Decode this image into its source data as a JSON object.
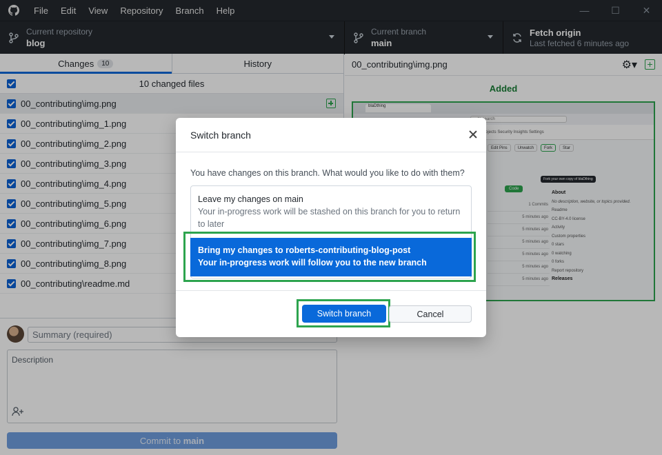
{
  "menu": [
    "File",
    "Edit",
    "View",
    "Repository",
    "Branch",
    "Help"
  ],
  "window_controls": [
    "—",
    "☐",
    "✕"
  ],
  "toolbar": {
    "repo_label": "Current repository",
    "repo_value": "blog",
    "branch_label": "Current branch",
    "branch_value": "main",
    "fetch_label": "Fetch origin",
    "fetch_sub": "Last fetched 6 minutes ago"
  },
  "tabs": {
    "changes": "Changes",
    "changes_count": "10",
    "history": "History"
  },
  "files_header": "10 changed files",
  "files": [
    "00_contributing\\img.png",
    "00_contributing\\img_1.png",
    "00_contributing\\img_2.png",
    "00_contributing\\img_3.png",
    "00_contributing\\img_4.png",
    "00_contributing\\img_5.png",
    "00_contributing\\img_6.png",
    "00_contributing\\img_7.png",
    "00_contributing\\img_8.png",
    "00_contributing\\readme.md"
  ],
  "commit": {
    "summary_placeholder": "Summary (required)",
    "description_placeholder": "Description",
    "button_prefix": "Commit to ",
    "button_branch": "main"
  },
  "diff": {
    "path": "00_contributing\\img.png",
    "status": "Added"
  },
  "preview": {
    "tab_title": "blaDthing",
    "url": "to search",
    "nav": "rojects   Security   Insights   Settings",
    "buttons": [
      "Edit Pins",
      "Unwatch",
      "Fork",
      "Star"
    ],
    "tooltip": "Fork your own copy of blaDthing",
    "code_button": "Code",
    "commits_label": "1 Commits",
    "times": [
      "5 minutes ago",
      "5 minutes ago",
      "5 minutes ago",
      "5 minutes ago",
      "5 minutes ago",
      "5 minutes ago"
    ],
    "about_title": "About",
    "about_desc": "No description, website, or topics provided.",
    "about_items": [
      "Readme",
      "CC-BY-4.0 license",
      "Activity",
      "Custom properties",
      "0 stars",
      "0 watching",
      "0 forks",
      "Report repository"
    ],
    "releases": "Releases"
  },
  "modal": {
    "title": "Switch branch",
    "question": "You have changes on this branch. What would you like to do with them?",
    "option1_title": "Leave my changes on main",
    "option1_desc": "Your in-progress work will be stashed on this branch for you to return to later",
    "option2_title": "Bring my changes to roberts-contributing-blog-post",
    "option2_desc": "Your in-progress work will follow you to the new branch",
    "primary_button": "Switch branch",
    "secondary_button": "Cancel"
  },
  "colors": {
    "accent": "#0969da",
    "highlight": "#2da44e",
    "toolbar_bg": "#24292e"
  }
}
